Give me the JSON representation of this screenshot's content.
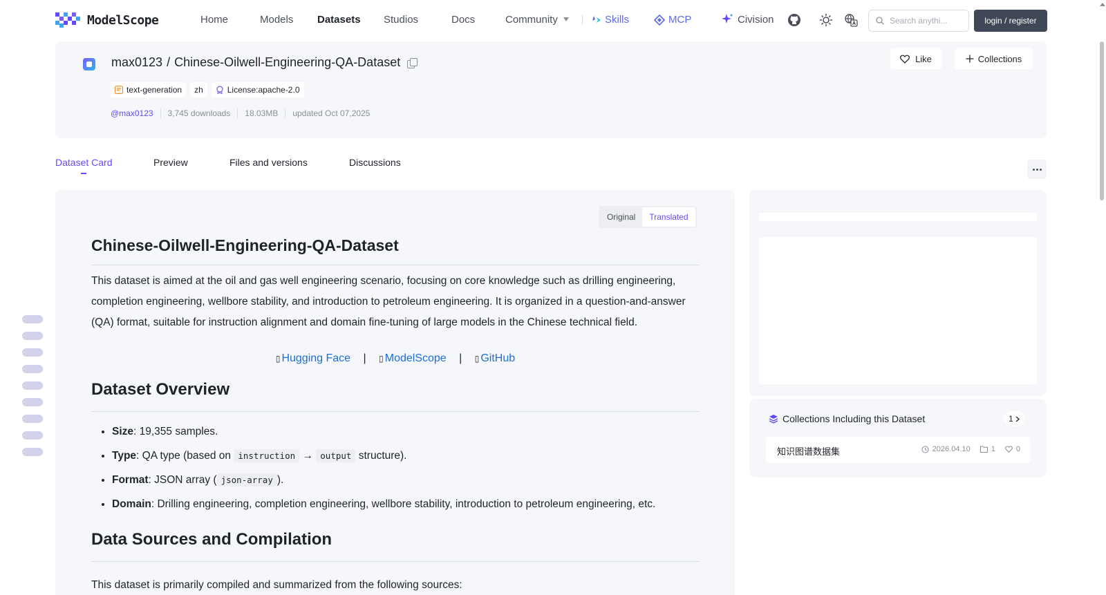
{
  "nav": {
    "logo_text": "ModelScope",
    "items": [
      "Home",
      "Models",
      "Datasets",
      "Studios",
      "Docs",
      "Community"
    ],
    "skills": "Skills",
    "mcp": "MCP",
    "civision": "Civision",
    "search_placeholder": "Search anythi...",
    "login": "login / register",
    "accent": "#624aff"
  },
  "header": {
    "owner": "max0123",
    "separator": "/",
    "name": "Chinese-Oilwell-Engineering-QA-Dataset",
    "tags": [
      "text-generation",
      "zh",
      "License:apache-2.0"
    ],
    "author": "@max0123",
    "downloads": "3,745 downloads",
    "size": "18.03MB",
    "updated": "updated Oct 07,2025",
    "like": "Like",
    "collections": "Collections"
  },
  "tabs": [
    "Dataset Card",
    "Preview",
    "Files and versions",
    "Discussions"
  ],
  "content": {
    "toggle_original": "Original",
    "toggle_translated": "Translated",
    "title": "Chinese-Oilwell-Engineering-QA-Dataset",
    "intro": "This dataset is aimed at the oil and gas well engineering scenario, focusing on core knowledge such as drilling engineering, completion engineering, wellbore stability, and introduction to petroleum engineering. It is organized in a question-and-answer (QA) format, suitable for instruction alignment and domain fine-tuning of large models in the Chinese technical field.",
    "links": {
      "hf": "Hugging Face",
      "ms": "ModelScope",
      "gh": "GitHub",
      "sep": "|",
      "prefix": "▯"
    },
    "overview_heading": "Dataset Overview",
    "overview": {
      "size_label": "Size",
      "size_text": ": 19,355 samples.",
      "type_label": "Type",
      "type_pre": ": QA type (based on ",
      "type_code1": "instruction",
      "type_arrow": " → ",
      "type_code2": "output",
      "type_post": " structure).",
      "format_label": "Format",
      "format_pre": ": JSON array (",
      "format_code": "json-array",
      "format_post": ").",
      "domain_label": "Domain",
      "domain_text": ": Drilling engineering, completion engineering, wellbore stability, introduction to petroleum engineering, etc."
    },
    "sources_heading": "Data Sources and Compilation",
    "sources_text": "This dataset is primarily compiled and summarized from the following sources:"
  },
  "sidebar": {
    "collections_title": "Collections Including this Dataset",
    "collections_count": "1",
    "item_name": "知识图谱数据集",
    "item_date": "2026.04.10",
    "item_files": "1",
    "item_likes": "0"
  }
}
